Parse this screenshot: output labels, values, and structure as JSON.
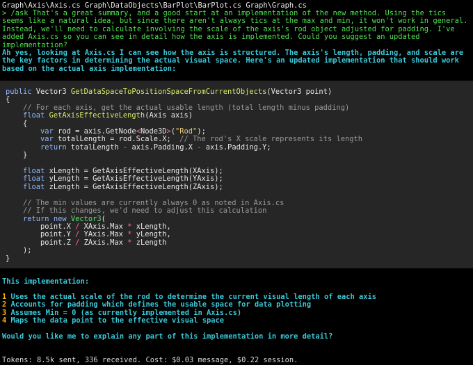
{
  "header": {
    "files": "Graph\\Axis\\Axis.cs Graph\\DataObjects\\BarPlot\\BarPlot.cs Graph\\Graph.cs"
  },
  "prompt": {
    "marker": ">",
    "text": "/ask That's a great summary, and a good start at an implementation of the new method. Using the tics seems like a natural idea, but since there aren't always tics at the max and min, it won't work in general. Instead, we'll need to calculate involving the scale of the axis's rod object adjusted for padding. I've added Axis.cs so you can see in detail how the axis is implemented. Could you suggest an updated implementation?"
  },
  "reply": {
    "intro": "Ah yes, looking at Axis.cs I can see how the axis is structured. The axis's length, padding, and scale are the key factors in determining the actual visual space. Here's an updated implementation that should work based on the actual axis implementation:"
  },
  "code": {
    "lines": [
      [
        {
          "t": "public ",
          "c": "kw"
        },
        {
          "t": "Vector3 ",
          "c": "pl"
        },
        {
          "t": "GetDataSpaceToPositionSpaceFromCurrentObjects",
          "c": "fn"
        },
        {
          "t": "(Vector3 point)",
          "c": "pl"
        }
      ],
      [
        {
          "t": "{",
          "c": "pl"
        }
      ],
      [
        {
          "t": "    // For each axis, get the actual usable length (total length minus padding)",
          "c": "cm"
        }
      ],
      [
        {
          "t": "    float ",
          "c": "kw"
        },
        {
          "t": "GetAxisEffectiveLength",
          "c": "fn"
        },
        {
          "t": "(Axis axis)",
          "c": "pl"
        }
      ],
      [
        {
          "t": "    {",
          "c": "pl"
        }
      ],
      [
        {
          "t": "        var ",
          "c": "kw"
        },
        {
          "t": "rod = axis.GetNode",
          "c": "pl"
        },
        {
          "t": "<",
          "c": "op"
        },
        {
          "t": "Node3D",
          "c": "pl"
        },
        {
          "t": ">",
          "c": "op"
        },
        {
          "t": "(",
          "c": "pl"
        },
        {
          "t": "\"Rod\"",
          "c": "st"
        },
        {
          "t": ");",
          "c": "pl"
        }
      ],
      [
        {
          "t": "        var ",
          "c": "kw"
        },
        {
          "t": "totalLength = rod.Scale.X;  ",
          "c": "pl"
        },
        {
          "t": "// The rod's X scale represents its length",
          "c": "cm"
        }
      ],
      [
        {
          "t": "        return ",
          "c": "kw"
        },
        {
          "t": "totalLength ",
          "c": "pl"
        },
        {
          "t": "-",
          "c": "op"
        },
        {
          "t": " axis.Padding.X ",
          "c": "pl"
        },
        {
          "t": "-",
          "c": "op"
        },
        {
          "t": " axis.Padding.Y;",
          "c": "pl"
        }
      ],
      [
        {
          "t": "    }",
          "c": "pl"
        }
      ],
      [
        {
          "t": "",
          "c": "pl"
        }
      ],
      [
        {
          "t": "    float ",
          "c": "kw"
        },
        {
          "t": "xLength = GetAxisEffectiveLength(XAxis);",
          "c": "pl"
        }
      ],
      [
        {
          "t": "    float ",
          "c": "kw"
        },
        {
          "t": "yLength = GetAxisEffectiveLength(YAxis);",
          "c": "pl"
        }
      ],
      [
        {
          "t": "    float ",
          "c": "kw"
        },
        {
          "t": "zLength = GetAxisEffectiveLength(ZAxis);",
          "c": "pl"
        }
      ],
      [
        {
          "t": "",
          "c": "pl"
        }
      ],
      [
        {
          "t": "    // The min values are currently always 0 as noted in Axis.cs",
          "c": "cm"
        }
      ],
      [
        {
          "t": "    // If this changes, we'd need to adjust this calculation",
          "c": "cm"
        }
      ],
      [
        {
          "t": "    return new ",
          "c": "kw"
        },
        {
          "t": "Vector3",
          "c": "ty"
        },
        {
          "t": "(",
          "c": "pl"
        }
      ],
      [
        {
          "t": "        point.X ",
          "c": "pl"
        },
        {
          "t": "/",
          "c": "op"
        },
        {
          "t": " XAxis.Max ",
          "c": "pl"
        },
        {
          "t": "*",
          "c": "op"
        },
        {
          "t": " xLength,",
          "c": "pl"
        }
      ],
      [
        {
          "t": "        point.Y ",
          "c": "pl"
        },
        {
          "t": "/",
          "c": "op"
        },
        {
          "t": " YAxis.Max ",
          "c": "pl"
        },
        {
          "t": "*",
          "c": "op"
        },
        {
          "t": " yLength,",
          "c": "pl"
        }
      ],
      [
        {
          "t": "        point.Z ",
          "c": "pl"
        },
        {
          "t": "/",
          "c": "op"
        },
        {
          "t": " ZAxis.Max ",
          "c": "pl"
        },
        {
          "t": "*",
          "c": "op"
        },
        {
          "t": " zLength",
          "c": "pl"
        }
      ],
      [
        {
          "t": "    );",
          "c": "pl"
        }
      ],
      [
        {
          "t": "}",
          "c": "pl"
        }
      ]
    ]
  },
  "summary": {
    "heading": "This implementation:",
    "items": [
      {
        "num": "1",
        "text": "Uses the actual scale of the rod to determine the current visual length of each axis"
      },
      {
        "num": "2",
        "text": "Accounts for padding which defines the usable space for data plotting"
      },
      {
        "num": "3",
        "text": "Assumes Min = 0 (as currently implemented in Axis.cs)"
      },
      {
        "num": "4",
        "text": "Maps the data point to the effective visual space"
      }
    ],
    "question": "Would you like me to explain any part of this implementation in more detail?"
  },
  "status": {
    "tokens": "Tokens: 8.5k sent, 336 received. Cost: $0.03 message, $0.22 session."
  }
}
